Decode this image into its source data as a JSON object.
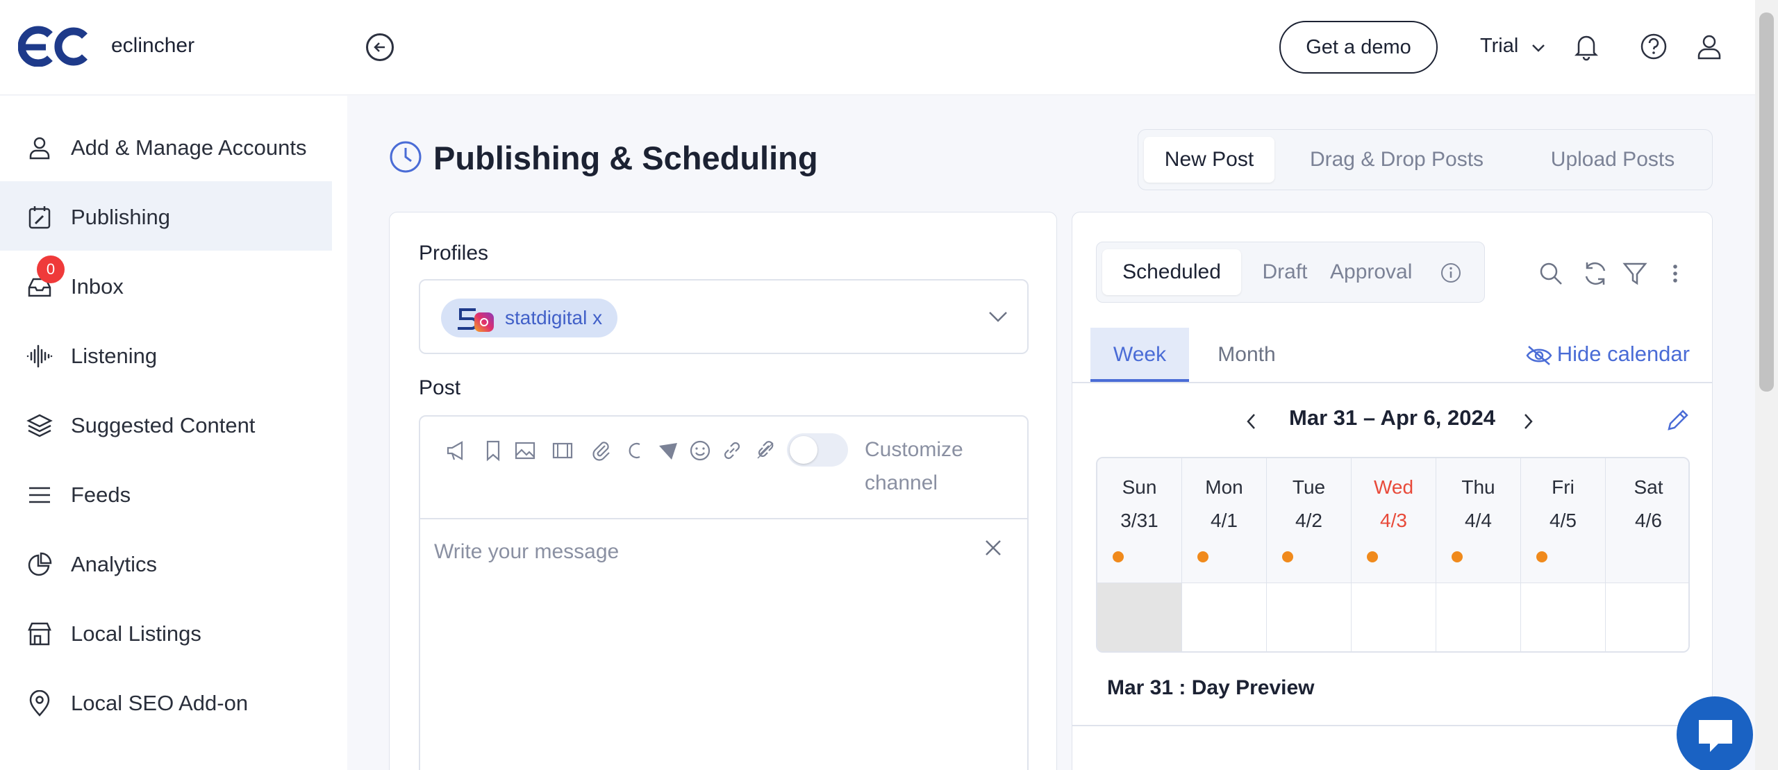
{
  "app": {
    "brand": "eclincher",
    "header": {
      "demo_button": "Get a demo",
      "plan": "Trial"
    }
  },
  "sidebar": {
    "items": [
      {
        "label": "Add & Manage Accounts",
        "icon": "user-icon"
      },
      {
        "label": "Publishing",
        "icon": "calendar-edit-icon",
        "active": true
      },
      {
        "label": "Inbox",
        "icon": "inbox-icon",
        "badge": "0"
      },
      {
        "label": "Listening",
        "icon": "soundwave-icon"
      },
      {
        "label": "Suggested Content",
        "icon": "layers-icon"
      },
      {
        "label": "Feeds",
        "icon": "list-icon"
      },
      {
        "label": "Analytics",
        "icon": "pie-chart-icon"
      },
      {
        "label": "Local Listings",
        "icon": "store-icon"
      },
      {
        "label": "Local SEO Add-on",
        "icon": "map-pin-icon"
      }
    ]
  },
  "main": {
    "title": "Publishing & Scheduling",
    "post_tabs": [
      "New Post",
      "Drag & Drop Posts",
      "Upload Posts"
    ],
    "compose": {
      "profiles_label": "Profiles",
      "profile_chip": "statdigital",
      "profile_chip_remove": "x",
      "post_label": "Post",
      "customize_label": "Customize channel",
      "customize_enabled": false,
      "message_placeholder": "Write your message"
    },
    "calendar": {
      "status_tabs": [
        "Scheduled",
        "Draft",
        "Approval"
      ],
      "view_tabs": [
        "Week",
        "Month"
      ],
      "hide_calendar": "Hide calendar",
      "range": "Mar 31 – Apr 6, 2024",
      "days": [
        {
          "name": "Sun",
          "date": "3/31",
          "dot": true
        },
        {
          "name": "Mon",
          "date": "4/1",
          "dot": true
        },
        {
          "name": "Tue",
          "date": "4/2",
          "dot": true
        },
        {
          "name": "Wed",
          "date": "4/3",
          "dot": true,
          "today": true
        },
        {
          "name": "Thu",
          "date": "4/4",
          "dot": true
        },
        {
          "name": "Fri",
          "date": "4/5",
          "dot": true
        },
        {
          "name": "Sat",
          "date": "4/6",
          "dot": false
        }
      ],
      "day_preview": "Mar 31 : Day Preview"
    }
  },
  "colors": {
    "accent": "#4a6cd6",
    "today": "#e84a3a",
    "dot": "#f08a1c",
    "chat": "#1a62c3"
  }
}
